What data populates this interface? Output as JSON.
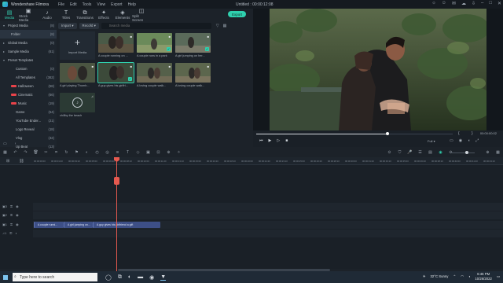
{
  "titlebar": {
    "app_name": "Wondershare Filmora",
    "menu": [
      "File",
      "Edit",
      "Tools",
      "View",
      "Export",
      "Help"
    ],
    "project": "Untitled : 00:00:12:08"
  },
  "toolbar": {
    "items": [
      {
        "label": "Media",
        "icon": "folder-icon"
      },
      {
        "label": "Stock Media",
        "icon": "stock-icon"
      },
      {
        "label": "Audio",
        "icon": "music-icon"
      },
      {
        "label": "Titles",
        "icon": "text-icon"
      },
      {
        "label": "Transitions",
        "icon": "transition-icon"
      },
      {
        "label": "Effects",
        "icon": "effects-icon"
      },
      {
        "label": "Elements",
        "icon": "elements-icon"
      },
      {
        "label": "Split Screen",
        "icon": "split-icon"
      }
    ],
    "export_label": "Export"
  },
  "sidebar": {
    "items": [
      {
        "label": "Project Media",
        "count": "(8)"
      },
      {
        "label": "Folder",
        "count": "(8)"
      },
      {
        "label": "Global Media",
        "count": "(0)"
      },
      {
        "label": "Sample Media",
        "count": "(61)"
      },
      {
        "label": "Preset Templates",
        "count": ""
      },
      {
        "label": "Custom",
        "count": "(0)"
      },
      {
        "label": "All Templates",
        "count": "(362)"
      },
      {
        "label": "Halloween",
        "count": "(58)"
      },
      {
        "label": "Cinematic",
        "count": "(66)"
      },
      {
        "label": "Music",
        "count": "(19)"
      },
      {
        "label": "Game",
        "count": "(54)"
      },
      {
        "label": "YouTube Ender...",
        "count": "(21)"
      },
      {
        "label": "Logo Reveal",
        "count": "(18)"
      },
      {
        "label": "Vlog",
        "count": "(32)"
      },
      {
        "label": "Up Beat",
        "count": "(13)"
      }
    ]
  },
  "mediabar": {
    "import_label": "Import",
    "record_label": "Record",
    "search_placeholder": "Search media"
  },
  "media": {
    "import_label": "Import Media",
    "thumbs": [
      "A couple running on ...",
      "A couple runs in a park",
      "A girl jumping on her...",
      "A girl playing Thumb...",
      "A guy gives his girlfri...",
      "A loving couple walk...",
      "A loving couple walk..."
    ],
    "music_label": "chillby the beach"
  },
  "preview": {
    "timecode": "00:00:00:02",
    "quality": "Full"
  },
  "ruler": {
    "ticks": [
      "00:00:00:00",
      "00:00:01:20",
      "00:00:03:10",
      "00:00:05:00",
      "00:00:06:20",
      "00:00:08:10",
      "00:00:10:00",
      "00:00:11:20",
      "00:00:13:10",
      "00:00:15:00",
      "00:00:16:20",
      "00:00:18:10",
      "00:00:20:00",
      "00:00:21:20",
      "00:00:23:10",
      "00:00:25:00",
      "00:00:26:20",
      "00:00:28:10",
      "00:00:30:00",
      "00:00:31:20",
      "00:00:33:10",
      "00:00:35:00",
      "00:00:36:20",
      "00:00:38:10",
      "00:00:40:00",
      "00:00:41:20",
      "00:00:43:10"
    ]
  },
  "timeline": {
    "clips": [
      "A couple runni...",
      "A girl jumping on...",
      "A guy gives his girlfriend a gift"
    ]
  },
  "taskbar": {
    "search_placeholder": "Type here to search",
    "weather": "32°C  Sunny",
    "time": "6:46 PM",
    "date": "10/26/2022"
  }
}
